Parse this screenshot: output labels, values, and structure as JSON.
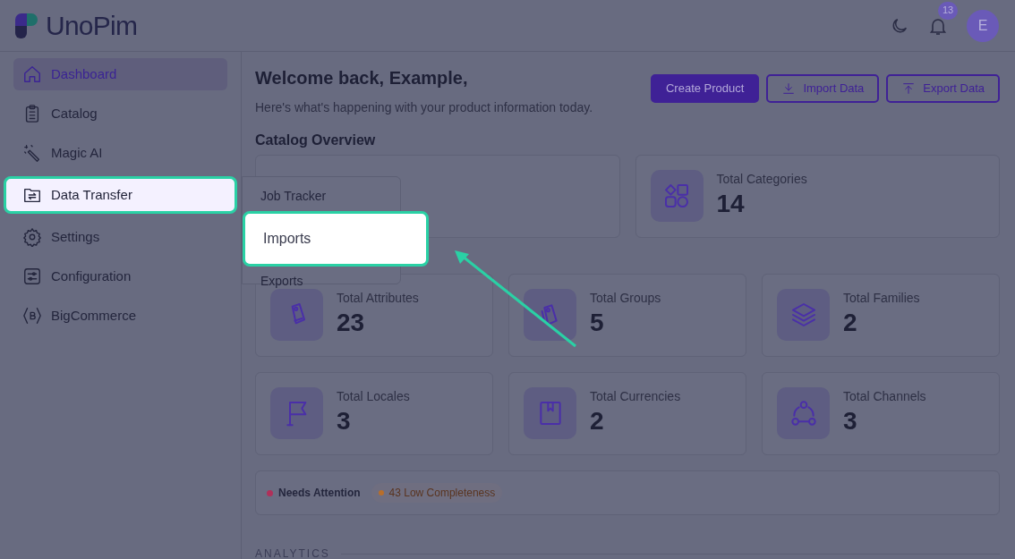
{
  "logo": {
    "text": "UnoPim"
  },
  "header": {
    "notification_count": "13",
    "avatar": "E"
  },
  "sidebar": {
    "items": [
      {
        "label": "Dashboard",
        "selected": true,
        "highlighted": false
      },
      {
        "label": "Catalog",
        "selected": false,
        "highlighted": false
      },
      {
        "label": "Magic AI",
        "selected": false,
        "highlighted": false
      },
      {
        "label": "Data Transfer",
        "selected": false,
        "highlighted": true
      },
      {
        "label": "Settings",
        "selected": false,
        "highlighted": false
      },
      {
        "label": "Configuration",
        "selected": false,
        "highlighted": false
      },
      {
        "label": "BigCommerce",
        "selected": false,
        "highlighted": false
      }
    ]
  },
  "submenu": {
    "items": [
      {
        "label": "Job Tracker",
        "highlighted": false
      },
      {
        "label": "Imports",
        "highlighted": true
      },
      {
        "label": "Exports",
        "highlighted": false
      }
    ]
  },
  "welcome": {
    "title": "Welcome back, Example,",
    "subtitle": "Here's what's happening with your product information today."
  },
  "actions": [
    {
      "label": "Create Product",
      "kind": "primary"
    },
    {
      "label": "Import Data",
      "kind": "import"
    },
    {
      "label": "Export Data",
      "kind": "export"
    }
  ],
  "section_title": "Catalog Overview",
  "stats": [
    {
      "label": "Total Categories",
      "value": "14"
    },
    {
      "label": "Total Attributes",
      "value": "23"
    },
    {
      "label": "Total Groups",
      "value": "5"
    },
    {
      "label": "Total Families",
      "value": "2"
    },
    {
      "label": "Total Locales",
      "value": "3"
    },
    {
      "label": "Total Currencies",
      "value": "2"
    },
    {
      "label": "Total Channels",
      "value": "3"
    }
  ],
  "attention": {
    "title": "Needs Attention",
    "color": "#b0305a",
    "badges": [
      {
        "text": "43 Low Completeness",
        "color": "#b86e2a"
      }
    ]
  },
  "analytics_heading": "ANALYTICS"
}
